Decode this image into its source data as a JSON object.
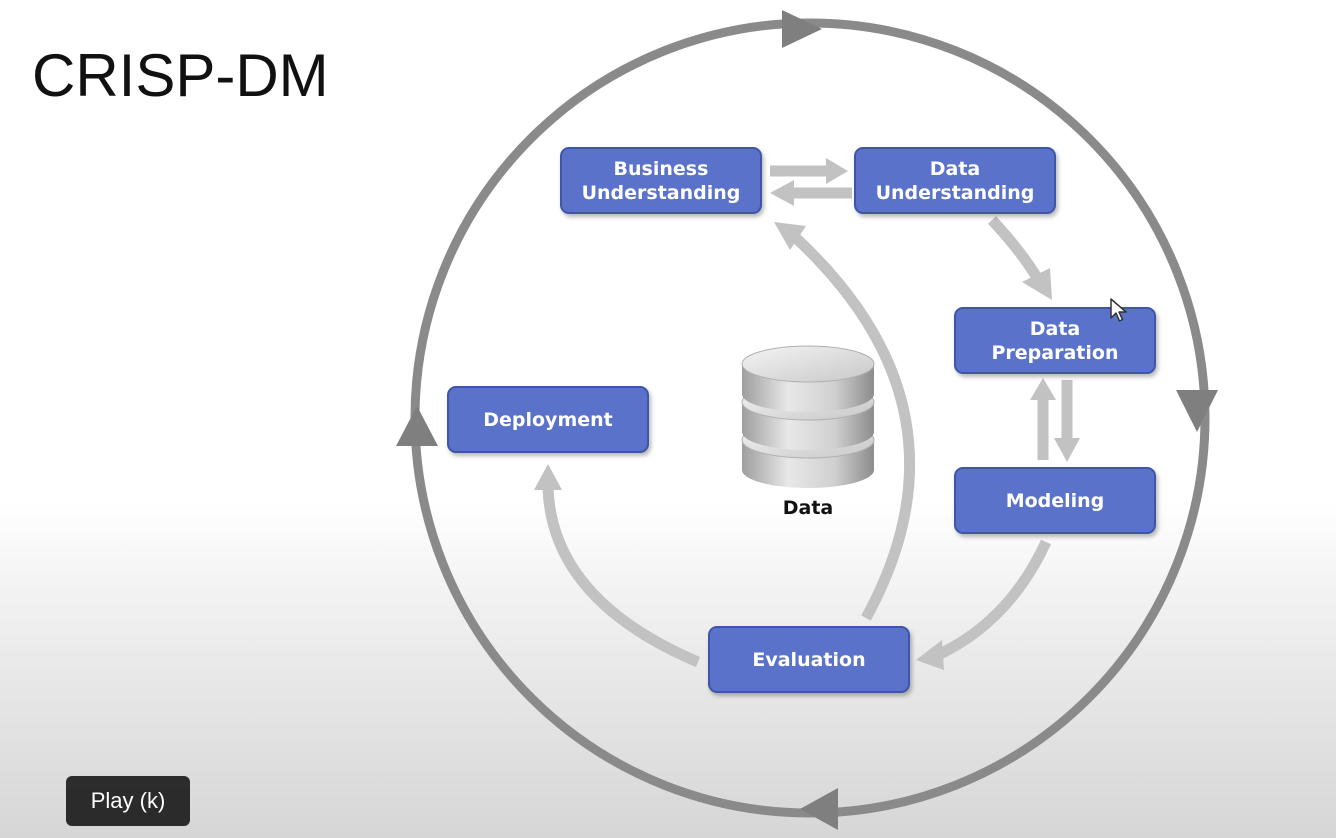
{
  "slide": {
    "title": "CRISP-DM"
  },
  "phases": {
    "business_understanding": "Business\nUnderstanding",
    "data_understanding": "Data\nUnderstanding",
    "data_preparation": "Data\nPreparation",
    "modeling": "Modeling",
    "evaluation": "Evaluation",
    "deployment": "Deployment"
  },
  "center": {
    "label": "Data",
    "icon": "database-icon"
  },
  "player": {
    "tooltip": "Play (k)"
  },
  "colors": {
    "phase_fill": "#5a72c9",
    "phase_border": "#3f56a8",
    "outer_cycle": "#8a8a8a",
    "inner_arrows": "#c2c2c2"
  }
}
